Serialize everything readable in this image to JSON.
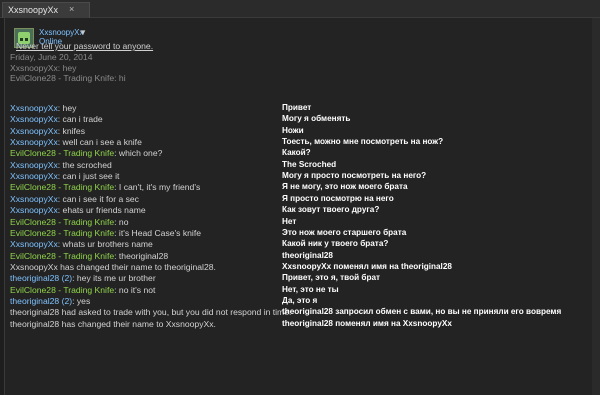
{
  "tab": {
    "title": "XxsnoopyXx",
    "close": "×"
  },
  "profile": {
    "name": "XxsnoopyXx",
    "dropdown_icon": "▼",
    "status": "Online"
  },
  "warning": "Never tell your password to anyone.",
  "date": "Friday, June 20, 2014",
  "history": [
    {
      "sender": "XxsnoopyXx",
      "text": "hey"
    },
    {
      "sender": "EvilClone28 - Trading Knife",
      "text": "hi"
    }
  ],
  "messages": [
    {
      "sender": "XxsnoopyXx",
      "text": "hey",
      "translation": "Привет"
    },
    {
      "sender": "XxsnoopyXx",
      "text": "can i trade",
      "translation": "Могу я обменять"
    },
    {
      "sender": "XxsnoopyXx",
      "text": "knifes",
      "translation": "Ножи"
    },
    {
      "sender": "XxsnoopyXx",
      "text": "well can i see a knife",
      "translation": "Тоесть, можно мне посмотреть на нож?"
    },
    {
      "sender": "EvilClone28 - Trading Knife",
      "text": "which one?",
      "translation": "Какой?"
    },
    {
      "sender": "XxsnoopyXx",
      "text": "the scroched",
      "translation": "The Scroched"
    },
    {
      "sender": "XxsnoopyXx",
      "text": "can i just see it",
      "translation": "Могу я просто посмотреть на него?"
    },
    {
      "sender": "EvilClone28 - Trading Knife",
      "text": "I can't, it's my friend's",
      "translation": "Я не могу, это нож моего брата"
    },
    {
      "sender": "XxsnoopyXx",
      "text": "can i see it for a sec",
      "translation": "Я просто посмотрю на него"
    },
    {
      "sender": "XxsnoopyXx",
      "text": "ehats ur friends name",
      "translation": "Как зовут твоего друга?"
    },
    {
      "sender": "EvilClone28 - Trading Knife",
      "text": "no",
      "translation": "Нет"
    },
    {
      "sender": "EvilClone28 - Trading Knife",
      "text": "it's Head Case's knife",
      "translation": "Это нож моего старшего брата"
    },
    {
      "sender": "XxsnoopyXx",
      "text": "whats ur brothers name",
      "translation": "Какой ник у твоего брата?"
    },
    {
      "sender": "EvilClone28 - Trading Knife",
      "text": "theoriginal28",
      "translation": "theoriginal28"
    },
    {
      "system_text": "XxsnoopyXx has changed their name to theoriginal28.",
      "translation": "XxsnoopyXx поменял имя на theoriginal28"
    },
    {
      "sender": "theoriginal28 (2)",
      "text": "hey its me ur brother",
      "translation": "Привет, это я, твой брат"
    },
    {
      "sender": "EvilClone28 - Trading Knife",
      "text": "no it's not",
      "translation": "Нет, это не ты"
    },
    {
      "sender": "theoriginal28 (2)",
      "text": "yes",
      "translation": "Да, это я"
    },
    {
      "system_text": "theoriginal28 had asked to trade with you, but you did not respond in time.",
      "translation": "theoriginal28 запросил обмен с вами, но вы не приняли его вовремя"
    },
    {
      "system_text": "theoriginal28 has changed their name to XxsnoopyXx.",
      "translation": "theoriginal28 поменял имя на XxsnoopyXx"
    }
  ]
}
